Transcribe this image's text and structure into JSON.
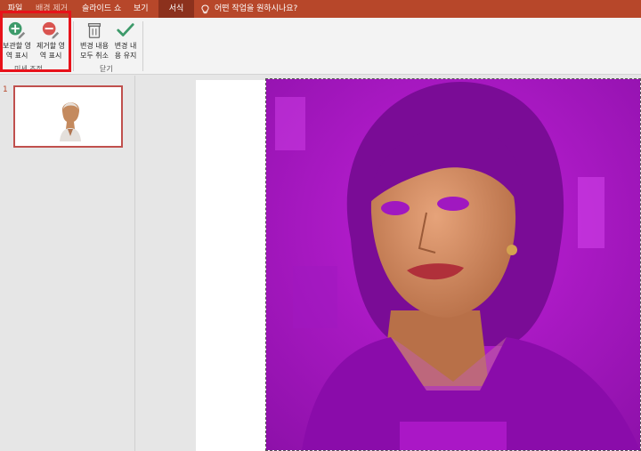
{
  "menu": {
    "file": "파일",
    "background_remove": "배경 제거",
    "slideshow": "슬라이드 쇼",
    "view": "보기",
    "format": "서식",
    "tell_me": "어떤 작업을 원하시나요?"
  },
  "ribbon": {
    "keep_line1": "보관할 영",
    "keep_line2": "역 표시",
    "remove_line1": "제거할 영",
    "remove_line2": "역 표시",
    "discard_line1": "변경 내용",
    "discard_line2": "모두 취소",
    "keepchanges_line1": "변경 내",
    "keepchanges_line2": "용 유지",
    "group_refine": "미세 조정",
    "group_close": "닫기"
  },
  "slides": {
    "current_number": "1"
  },
  "colors": {
    "accent": "#b7472a",
    "removal_overlay": "#a020c0",
    "highlight": "#e8121a"
  }
}
